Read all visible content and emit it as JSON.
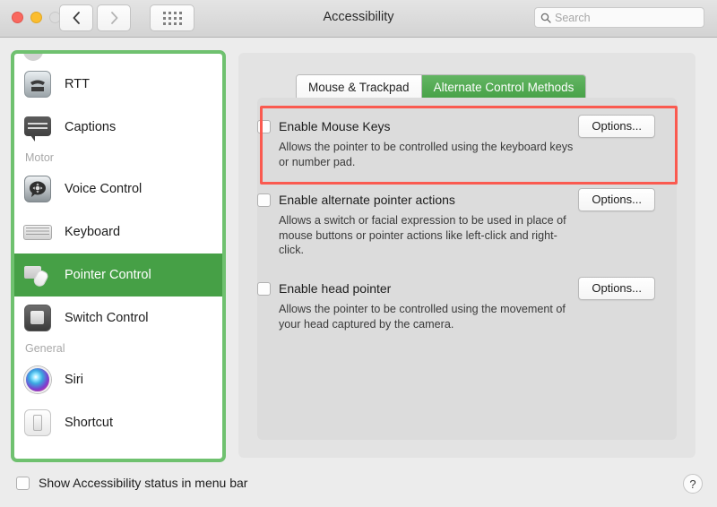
{
  "window": {
    "title": "Accessibility",
    "traffic_lights": [
      "close",
      "minimize",
      "zoom"
    ],
    "nav_back_icon": "chevron-left-icon",
    "nav_forward_icon": "chevron-right-icon",
    "grid_icon": "show-all-grid-icon"
  },
  "search": {
    "placeholder": "Search",
    "value": "",
    "icon": "search-icon"
  },
  "sidebar": {
    "items": [
      {
        "label": "RTT",
        "icon": "rtt-icon",
        "selected": false
      },
      {
        "label": "Captions",
        "icon": "captions-icon",
        "selected": false
      },
      {
        "group": "Motor"
      },
      {
        "label": "Voice Control",
        "icon": "voice-control-icon",
        "selected": false
      },
      {
        "label": "Keyboard",
        "icon": "keyboard-icon",
        "selected": false
      },
      {
        "label": "Pointer Control",
        "icon": "pointer-control-icon",
        "selected": true
      },
      {
        "label": "Switch Control",
        "icon": "switch-control-icon",
        "selected": false
      },
      {
        "group": "General"
      },
      {
        "label": "Siri",
        "icon": "siri-icon",
        "selected": false
      },
      {
        "label": "Shortcut",
        "icon": "shortcut-icon",
        "selected": false
      }
    ],
    "highlight_color": "#6fc16f",
    "selected_color": "#46a046"
  },
  "main": {
    "tabs": [
      {
        "label": "Mouse & Trackpad",
        "active": false
      },
      {
        "label": "Alternate Control Methods",
        "active": true
      }
    ],
    "options": [
      {
        "title": "Enable Mouse Keys",
        "description": "Allows the pointer to be controlled using the keyboard keys or number pad.",
        "checked": false,
        "button": "Options...",
        "highlighted": true
      },
      {
        "title": "Enable alternate pointer actions",
        "description": "Allows a switch or facial expression to be used in place of mouse buttons or pointer actions like left-click and right-click.",
        "checked": false,
        "button": "Options...",
        "highlighted": false
      },
      {
        "title": "Enable head pointer",
        "description": "Allows the pointer to be controlled using the movement of your head captured by the camera.",
        "checked": false,
        "button": "Options...",
        "highlighted": false
      }
    ],
    "annotation_color": "#fa5a50"
  },
  "footer": {
    "show_status_label": "Show Accessibility status in menu bar",
    "show_status_checked": false,
    "help_label": "?"
  }
}
